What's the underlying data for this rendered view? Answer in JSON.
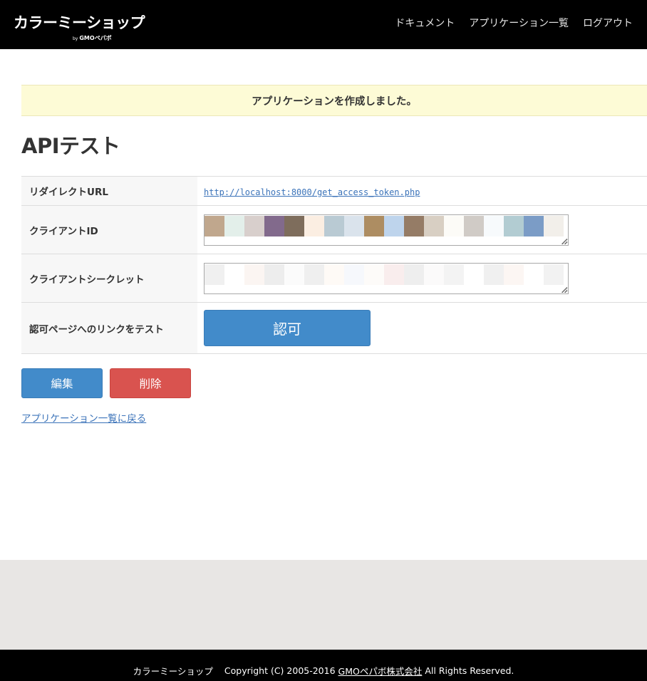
{
  "header": {
    "logo_main": "カラーミーショップ",
    "logo_by": "by",
    "logo_company": "GMOペパボ",
    "nav": [
      "ドキュメント",
      "アプリケーション一覧",
      "ログアウト"
    ]
  },
  "notice": "アプリケーションを作成しました。",
  "page_title": "APIテスト",
  "table": {
    "redirect_label": "リダイレクトURL",
    "redirect_url": "http://localhost:8000/get_access_token.php",
    "client_id_label": "クライアントID",
    "client_secret_label": "クライアントシークレット",
    "auth_label": "認可ページへのリンクをテスト",
    "auth_button": "認可"
  },
  "actions": {
    "edit": "編集",
    "delete": "削除"
  },
  "back_link": "アプリケーション一覧に戻る",
  "footer": {
    "brand": "カラーミーショップ",
    "copyright": "Copyright (C) 2005-2016",
    "company": "GMOペパボ株式会社",
    "rights": "All Rights Reserved."
  },
  "colors": {
    "primary": "#428bca",
    "danger": "#d9534f",
    "notice_bg": "#fdfbd6",
    "link": "#3b73b9",
    "header_bg": "#000000"
  },
  "masked_colors": {
    "client_id": [
      "#c0a78d",
      "#e3efea",
      "#d8cfcc",
      "#826a8c",
      "#7e6d5c",
      "#fbeee2",
      "#b9cad3",
      "#dae3ec",
      "#ad8d62",
      "#bed4ec",
      "#957c66",
      "#d8cfc3",
      "#fcfbf7",
      "#d0cbc6",
      "#f7fafc",
      "#b2ccd2",
      "#7b9cc6",
      "#f2efea"
    ],
    "client_secret": [
      "#f0f0f0",
      "#ffffff",
      "#fbf5f2",
      "#ededed",
      "#fbfbfb",
      "#efefef",
      "#fefaf6",
      "#f6f8fc",
      "#fdfbf9",
      "#f9eded",
      "#eeeeee",
      "#fbfafa",
      "#f3f3f3",
      "#ffffff",
      "#f0f0f0",
      "#fcf6f3",
      "#ffffff",
      "#f2f2f2"
    ]
  }
}
